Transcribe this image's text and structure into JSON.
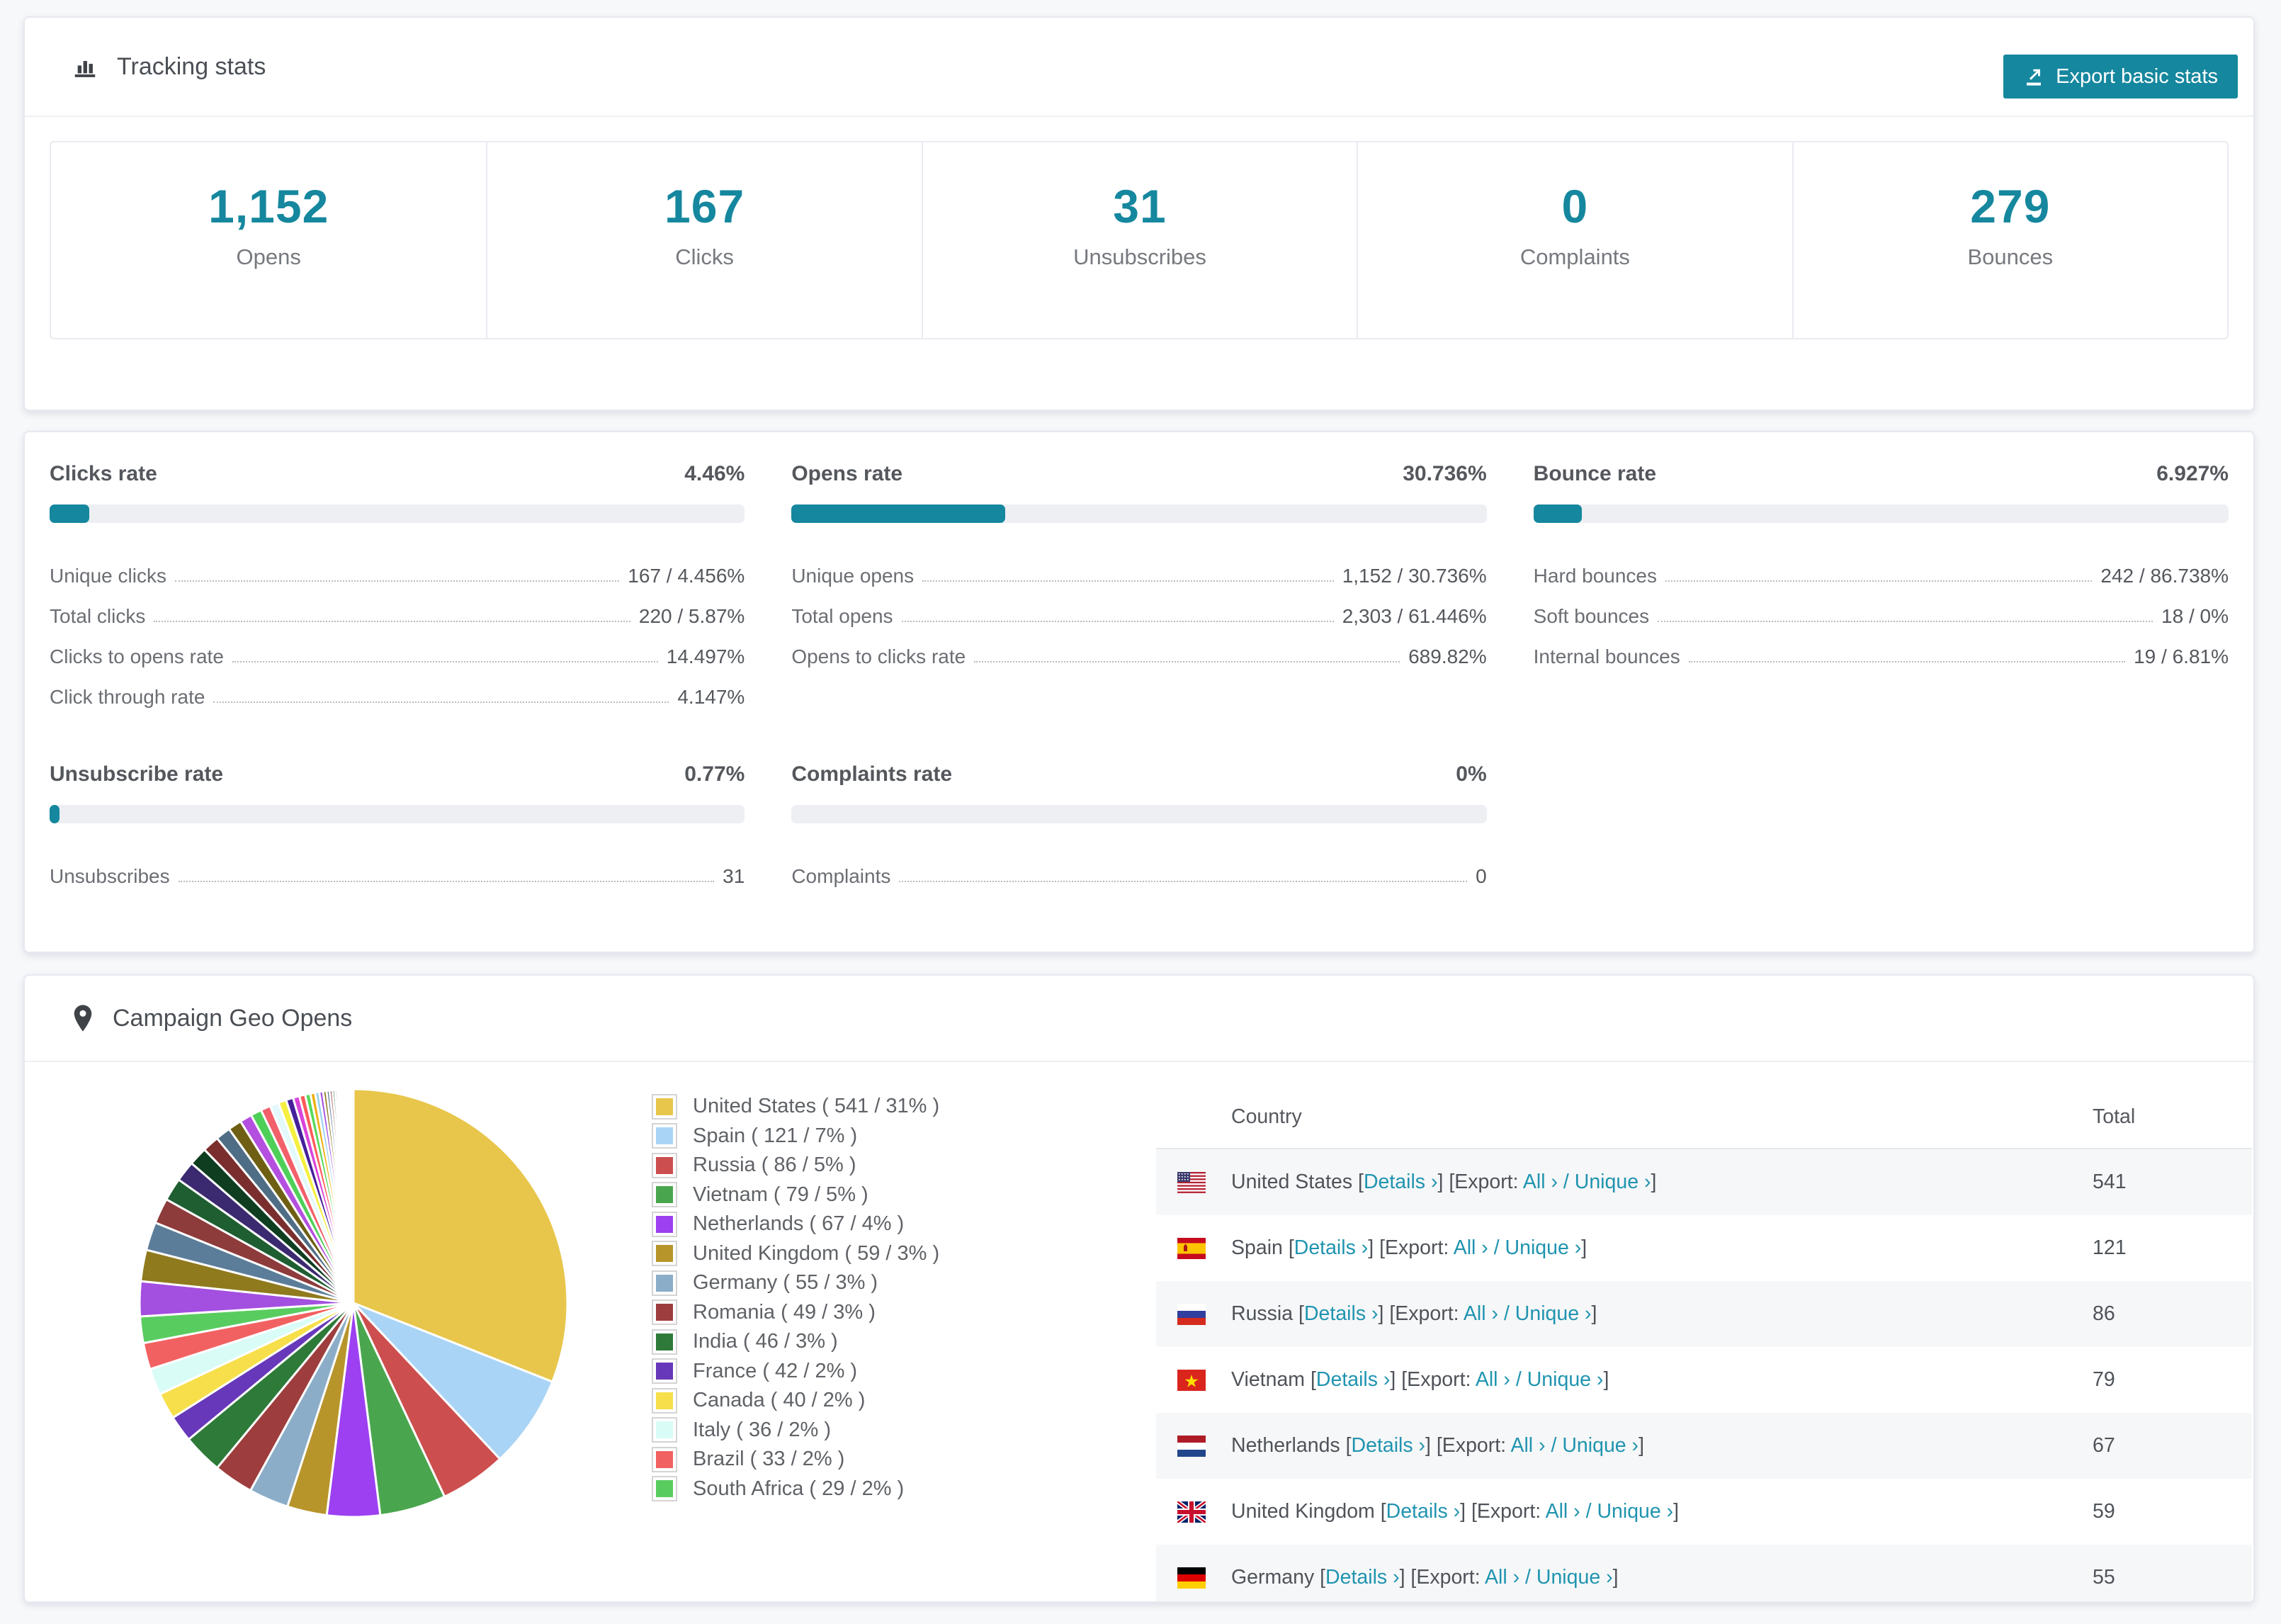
{
  "theme": {
    "teal": "#15879e",
    "link_color": "#2094b0",
    "bar_track": "#edeff3",
    "row_stripe": "#f6f7f8",
    "page_bg": "#f7f8fa"
  },
  "tracking": {
    "title": "Tracking stats",
    "title_icon": "bar-chart-icon",
    "export_button": {
      "label": "Export basic stats",
      "icon": "export-icon"
    },
    "stats": [
      {
        "value": "1,152",
        "label": "Opens"
      },
      {
        "value": "167",
        "label": "Clicks"
      },
      {
        "value": "31",
        "label": "Unsubscribes"
      },
      {
        "value": "0",
        "label": "Complaints"
      },
      {
        "value": "279",
        "label": "Bounces"
      }
    ]
  },
  "rates": {
    "cards": [
      {
        "title": "Clicks rate",
        "value": "4.46%",
        "bar_pct": 4.46,
        "rows": [
          {
            "label": "Unique clicks",
            "value": "167 / 4.456%"
          },
          {
            "label": "Total clicks",
            "value": "220 / 5.87%"
          },
          {
            "label": "Clicks to opens rate",
            "value": "14.497%"
          },
          {
            "label": "Click through rate",
            "value": "4.147%"
          }
        ]
      },
      {
        "title": "Opens rate",
        "value": "30.736%",
        "bar_pct": 30.736,
        "rows": [
          {
            "label": "Unique opens",
            "value": "1,152 / 30.736%"
          },
          {
            "label": "Total opens",
            "value": "2,303 / 61.446%"
          },
          {
            "label": "Opens to clicks rate",
            "value": "689.82%"
          }
        ]
      },
      {
        "title": "Bounce rate",
        "value": "6.927%",
        "bar_pct": 6.927,
        "rows": [
          {
            "label": "Hard bounces",
            "value": "242 / 86.738%"
          },
          {
            "label": "Soft bounces",
            "value": "18 / 0%"
          },
          {
            "label": "Internal bounces",
            "value": "19 / 6.81%"
          }
        ]
      },
      {
        "title": "Unsubscribe rate",
        "value": "0.77%",
        "bar_pct": 0.77,
        "rows": [
          {
            "label": "Unsubscribes",
            "value": "31"
          }
        ]
      },
      {
        "title": "Complaints rate",
        "value": "0%",
        "bar_pct": 0,
        "rows": [
          {
            "label": "Complaints",
            "value": "0"
          }
        ]
      }
    ]
  },
  "geo": {
    "title": "Campaign Geo Opens",
    "title_icon": "map-pin-icon",
    "legend": [
      {
        "label": "United States ( 541 / 31% )",
        "color": "#e8c64b"
      },
      {
        "label": "Spain ( 121 / 7% )",
        "color": "#aad4f5"
      },
      {
        "label": "Russia ( 86 / 5% )",
        "color": "#cd4e4e"
      },
      {
        "label": "Vietnam ( 79 / 5% )",
        "color": "#4aa64e"
      },
      {
        "label": "Netherlands ( 67 / 4% )",
        "color": "#9c40f2"
      },
      {
        "label": "United Kingdom ( 59 / 3% )",
        "color": "#b8952b"
      },
      {
        "label": "Germany ( 55 / 3% )",
        "color": "#8badc8"
      },
      {
        "label": "Romania ( 49 / 3% )",
        "color": "#9e3d3d"
      },
      {
        "label": "India ( 46 / 3% )",
        "color": "#2d7a39"
      },
      {
        "label": "France ( 42 / 2% )",
        "color": "#6738b9"
      },
      {
        "label": "Canada ( 40 / 2% )",
        "color": "#f6df4a"
      },
      {
        "label": "Italy ( 36 / 2% )",
        "color": "#d9fcf7"
      },
      {
        "label": "Brazil ( 33 / 2% )",
        "color": "#f26161"
      },
      {
        "label": "South Africa ( 29 / 2% )",
        "color": "#59cc5f"
      }
    ],
    "table": {
      "headers": {
        "country": "Country",
        "total": "Total"
      },
      "links": {
        "bracket_open": "[",
        "bracket_close": "]",
        "details": "Details ›",
        "export_prefix": "[Export:",
        "all": "All ›",
        "slash": "/",
        "unique": "Unique ›"
      },
      "rows": [
        {
          "country": "United States",
          "total": "541",
          "flag": "us"
        },
        {
          "country": "Spain",
          "total": "121",
          "flag": "es"
        },
        {
          "country": "Russia",
          "total": "86",
          "flag": "ru"
        },
        {
          "country": "Vietnam",
          "total": "79",
          "flag": "vn"
        },
        {
          "country": "Netherlands",
          "total": "67",
          "flag": "nl"
        },
        {
          "country": "United Kingdom",
          "total": "59",
          "flag": "gb"
        },
        {
          "country": "Germany",
          "total": "55",
          "flag": "de"
        }
      ]
    }
  },
  "chart_data": {
    "type": "pie",
    "title": "Campaign Geo Opens",
    "unit": "opens",
    "start_angle": "12 o'clock, clockwise",
    "legend_position": "right",
    "slices": [
      {
        "label": "United States",
        "value": 541,
        "pct": 31,
        "color": "#e8c64b"
      },
      {
        "label": "Spain",
        "value": 121,
        "pct": 7,
        "color": "#aad4f5"
      },
      {
        "label": "Russia",
        "value": 86,
        "pct": 5,
        "color": "#cd4e4e"
      },
      {
        "label": "Vietnam",
        "value": 79,
        "pct": 5,
        "color": "#4aa64e"
      },
      {
        "label": "Netherlands",
        "value": 67,
        "pct": 4,
        "color": "#9c40f2"
      },
      {
        "label": "United Kingdom",
        "value": 59,
        "pct": 3,
        "color": "#b8952b"
      },
      {
        "label": "Germany",
        "value": 55,
        "pct": 3,
        "color": "#8badc8"
      },
      {
        "label": "Romania",
        "value": 49,
        "pct": 3,
        "color": "#9e3d3d"
      },
      {
        "label": "India",
        "value": 46,
        "pct": 3,
        "color": "#2d7a39"
      },
      {
        "label": "France",
        "value": 42,
        "pct": 2,
        "color": "#6738b9"
      },
      {
        "label": "Canada",
        "value": 40,
        "pct": 2,
        "color": "#f6df4a"
      },
      {
        "label": "Italy",
        "value": 36,
        "pct": 2,
        "color": "#d9fcf7"
      },
      {
        "label": "Brazil",
        "value": 33,
        "pct": 2,
        "color": "#f26161"
      },
      {
        "label": "South Africa",
        "value": 29,
        "pct": 2,
        "color": "#59cc5f"
      }
    ],
    "others": {
      "note": "trailing unlabeled small slices (many countries)",
      "total_pct": 26,
      "slice_count": 42,
      "decay": 0.9,
      "palette": [
        "#a34fe0",
        "#8f7a1e",
        "#5b7d99",
        "#8e3b3b",
        "#1e5e31",
        "#3b2a70",
        "#0e3d20",
        "#7a2e2e",
        "#4f6d85",
        "#6e5f14",
        "#b44fe0",
        "#4ed058",
        "#f2606a",
        "#e3f9fb",
        "#f5ef3f",
        "#46209a",
        "#d945d9",
        "#ff5a5a",
        "#57d957",
        "#eeb010",
        "#9ad1f0"
      ]
    }
  }
}
